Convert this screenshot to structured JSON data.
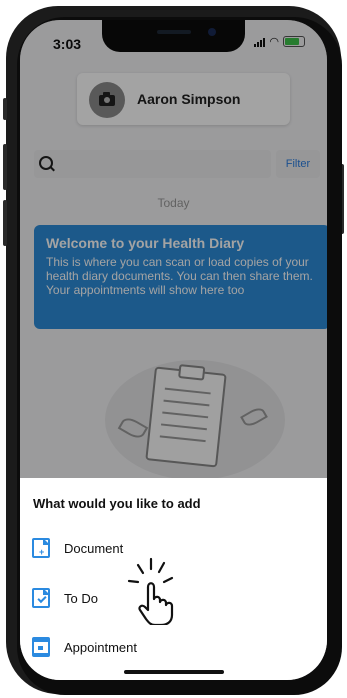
{
  "status_bar": {
    "time": "3:03"
  },
  "profile": {
    "name": "Aaron Simpson"
  },
  "search": {
    "placeholder": "",
    "filter_label": "Filter"
  },
  "feed": {
    "section_label": "Today"
  },
  "welcome_card": {
    "title": "Welcome to your Health Diary",
    "body": "This is where you can scan or load copies of your health diary documents. You can then share them. Your appointments will show here too"
  },
  "add_sheet": {
    "title": "What would you like to add",
    "options": [
      {
        "label": "Document",
        "icon": "document-add-icon"
      },
      {
        "label": "To Do",
        "icon": "todo-icon"
      },
      {
        "label": "Appointment",
        "icon": "calendar-icon"
      }
    ]
  },
  "colors": {
    "accent": "#2b8ae0",
    "welcome_bg": "#2c8bd8"
  }
}
